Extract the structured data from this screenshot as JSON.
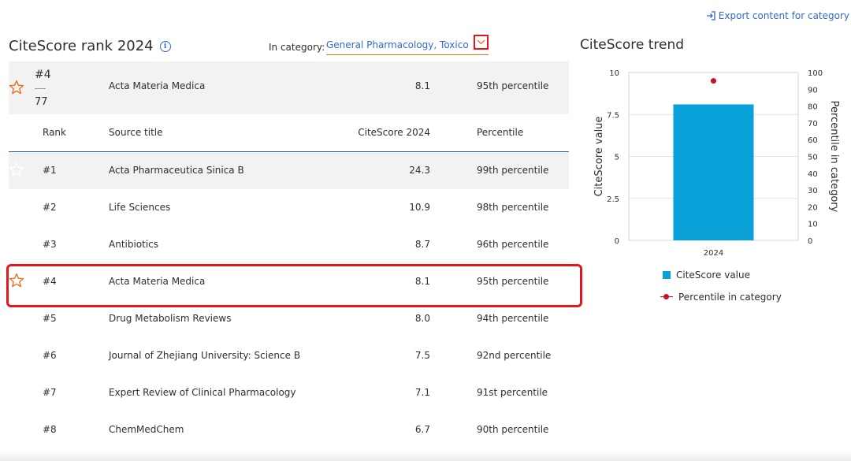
{
  "export_label": "Export content for category",
  "rank_section": {
    "title": "CiteScore rank 2024",
    "category_label": "In category:",
    "category_value": "General Pharmacology, Toxico..."
  },
  "summary": {
    "rank": "#4",
    "total": "77",
    "title": "Acta Materia Medica",
    "score": "8.1",
    "percentile": "95th percentile"
  },
  "table": {
    "headers": [
      "Rank",
      "Source title",
      "CiteScore 2024",
      "Percentile"
    ],
    "rows": [
      {
        "rank": "#1",
        "title": "Acta Pharmaceutica Sinica B",
        "score": "24.3",
        "percentile": "99th percentile"
      },
      {
        "rank": "#2",
        "title": "Life Sciences",
        "score": "10.9",
        "percentile": "98th percentile"
      },
      {
        "rank": "#3",
        "title": "Antibiotics",
        "score": "8.7",
        "percentile": "96th percentile"
      },
      {
        "rank": "#4",
        "title": "Acta Materia Medica",
        "score": "8.1",
        "percentile": "95th percentile"
      },
      {
        "rank": "#5",
        "title": "Drug Metabolism Reviews",
        "score": "8.0",
        "percentile": "94th percentile"
      },
      {
        "rank": "#6",
        "title": "Journal of Zhejiang University: Science B",
        "score": "7.5",
        "percentile": "92nd percentile"
      },
      {
        "rank": "#7",
        "title": "Expert Review of Clinical Pharmacology",
        "score": "7.1",
        "percentile": "91st percentile"
      },
      {
        "rank": "#8",
        "title": "ChemMedChem",
        "score": "6.7",
        "percentile": "90th percentile"
      }
    ]
  },
  "trend": {
    "title": "CiteScore trend"
  },
  "chart_data": {
    "type": "bar",
    "categories": [
      "2024"
    ],
    "series": [
      {
        "name": "CiteScore value",
        "values": [
          8.1
        ],
        "axis": "left",
        "color": "#0aa0d8"
      },
      {
        "name": "Percentile in category",
        "values": [
          95
        ],
        "axis": "right",
        "color": "#c8102e",
        "marker": "point"
      }
    ],
    "ylabel": "CiteScore value",
    "ylim": [
      0,
      10
    ],
    "yticks": [
      "10",
      "7.5",
      "5",
      "2.5",
      "0"
    ],
    "y2label": "Percentile in category",
    "y2lim": [
      0,
      100
    ],
    "y2ticks": [
      "100",
      "90",
      "80",
      "70",
      "60",
      "50",
      "40",
      "30",
      "20",
      "10",
      "0"
    ],
    "grid": true,
    "legend": "bottom"
  },
  "colors": {
    "accent_blue": "#2e6bd4",
    "bar": "#0aa0d8",
    "percentile_point": "#c8102e",
    "star": "#e9711c",
    "highlight": "#e4161d"
  }
}
